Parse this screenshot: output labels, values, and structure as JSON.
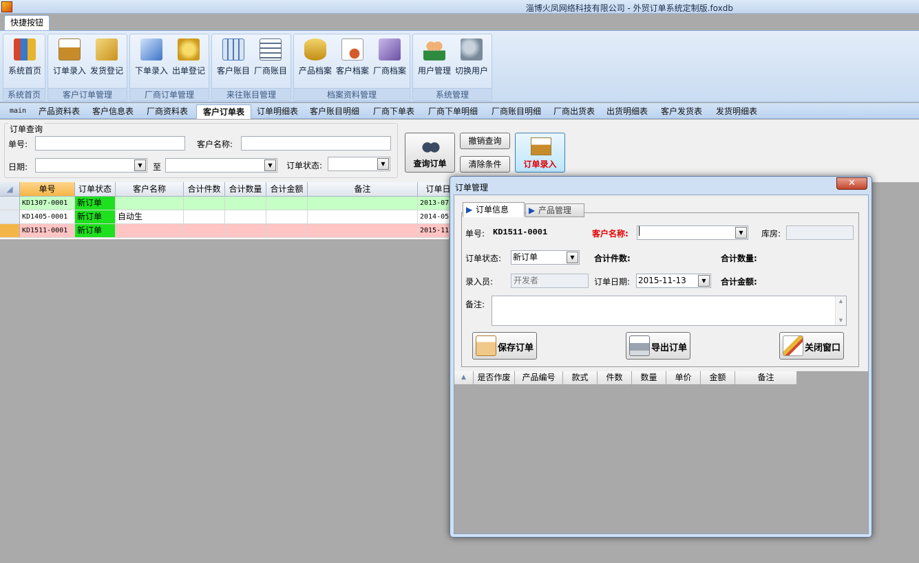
{
  "window": {
    "title": "淄博火凤网络科技有限公司 - 外贸订单系统定制版.foxdb"
  },
  "ribbon": {
    "tab": "快捷按钮",
    "groups": [
      {
        "label": "系统首页",
        "buttons": [
          {
            "label": "系统首页",
            "icon": "bar-chart-icon",
            "color": "#d9452a"
          }
        ]
      },
      {
        "label": "客户订单管理",
        "buttons": [
          {
            "label": "订单录入",
            "icon": "order-entry-icon",
            "color": "#c88b2a"
          },
          {
            "label": "发货登记",
            "icon": "shipping-icon",
            "color": "#e0b43a"
          }
        ]
      },
      {
        "label": "厂商订单管理",
        "buttons": [
          {
            "label": "下单录入",
            "icon": "draw-tools-icon",
            "color": "#3d74c7"
          },
          {
            "label": "出单登记",
            "icon": "coins-icon",
            "color": "#e5b42c"
          }
        ]
      },
      {
        "label": "来往账目管理",
        "buttons": [
          {
            "label": "客户账目",
            "icon": "calculator-icon",
            "color": "#4b79b8"
          },
          {
            "label": "厂商账目",
            "icon": "ledger-icon",
            "color": "#5a6f8c"
          }
        ]
      },
      {
        "label": "档案资料管理",
        "buttons": [
          {
            "label": "产品档案",
            "icon": "database-icon",
            "color": "#d9a51c"
          },
          {
            "label": "客户档案",
            "icon": "certificate-icon",
            "color": "#d45a2a"
          },
          {
            "label": "厂商档案",
            "icon": "monitor-icon",
            "color": "#6b4fa3"
          }
        ]
      },
      {
        "label": "系统管理",
        "buttons": [
          {
            "label": "用户管理",
            "icon": "users-icon",
            "color": "#2e8b3e"
          },
          {
            "label": "切换用户",
            "icon": "switch-user-icon",
            "color": "#7a8a9a"
          }
        ]
      }
    ]
  },
  "module_tabs": [
    "main",
    "产品资料表",
    "客户信息表",
    "厂商资料表",
    "客户订单表",
    "订单明细表",
    "客户账目明细",
    "厂商下单表",
    "厂商下单明细",
    "厂商账目明细",
    "厂商出货表",
    "出货明细表",
    "客户发货表",
    "发货明细表"
  ],
  "active_module": "客户订单表",
  "query": {
    "legend": "订单查询",
    "order_no_label": "单号:",
    "order_no_value": "",
    "customer_label": "客户名称:",
    "customer_value": "",
    "date_label": "日期:",
    "date_from": "",
    "to_label": "至",
    "date_to": "",
    "status_label": "订单状态:",
    "status_value": "",
    "search_btn": "查询订单",
    "cancel_btn": "撤销查询",
    "clear_btn": "清除条件",
    "entry_btn": "订单录入"
  },
  "grid": {
    "columns": [
      "单号",
      "订单状态",
      "客户名称",
      "合计件数",
      "合计数量",
      "合计金额",
      "备注",
      "订单日"
    ],
    "rows": [
      {
        "no": "KD1307-0001",
        "status": "新订单",
        "customer": "",
        "qty": "",
        "amount": "",
        "total": "",
        "note": "",
        "date": "2013-07",
        "bg": "#c6ffc6"
      },
      {
        "no": "KD1405-0001",
        "status": "新订单",
        "customer": "自动生",
        "qty": "",
        "amount": "",
        "total": "",
        "note": "",
        "date": "2014-05",
        "bg": "#ffffff"
      },
      {
        "no": "KD1511-0001",
        "status": "新订单",
        "customer": "",
        "qty": "",
        "amount": "",
        "total": "",
        "note": "",
        "date": "2015-11",
        "bg": "#ffc4c4"
      }
    ],
    "status_color": "#1ee01e"
  },
  "dialog": {
    "title": "订单管理",
    "close": "✕",
    "tabs": [
      "订单信息",
      "产品管理"
    ],
    "order_no_label": "单号:",
    "order_no_value": "KD1511-0001",
    "customer_label": "客户名称:",
    "customer_value": "",
    "warehouse_label": "库房:",
    "warehouse_value": "",
    "status_label": "订单状态:",
    "status_value": "新订单",
    "total_pieces_label": "合计件数:",
    "total_qty_label": "合计数量:",
    "entered_by_label": "录入员:",
    "entered_by_value": "开发者",
    "order_date_label": "订单日期:",
    "order_date_value": "2015-11-13",
    "total_amount_label": "合计金额:",
    "note_label": "备注:",
    "note_value": "",
    "save_btn": "保存订单",
    "export_btn": "导出订单",
    "close_btn": "关闭窗口",
    "detail_columns": [
      "是否作废",
      "产品编号",
      "款式",
      "件数",
      "数量",
      "单价",
      "金额",
      "备注"
    ]
  }
}
